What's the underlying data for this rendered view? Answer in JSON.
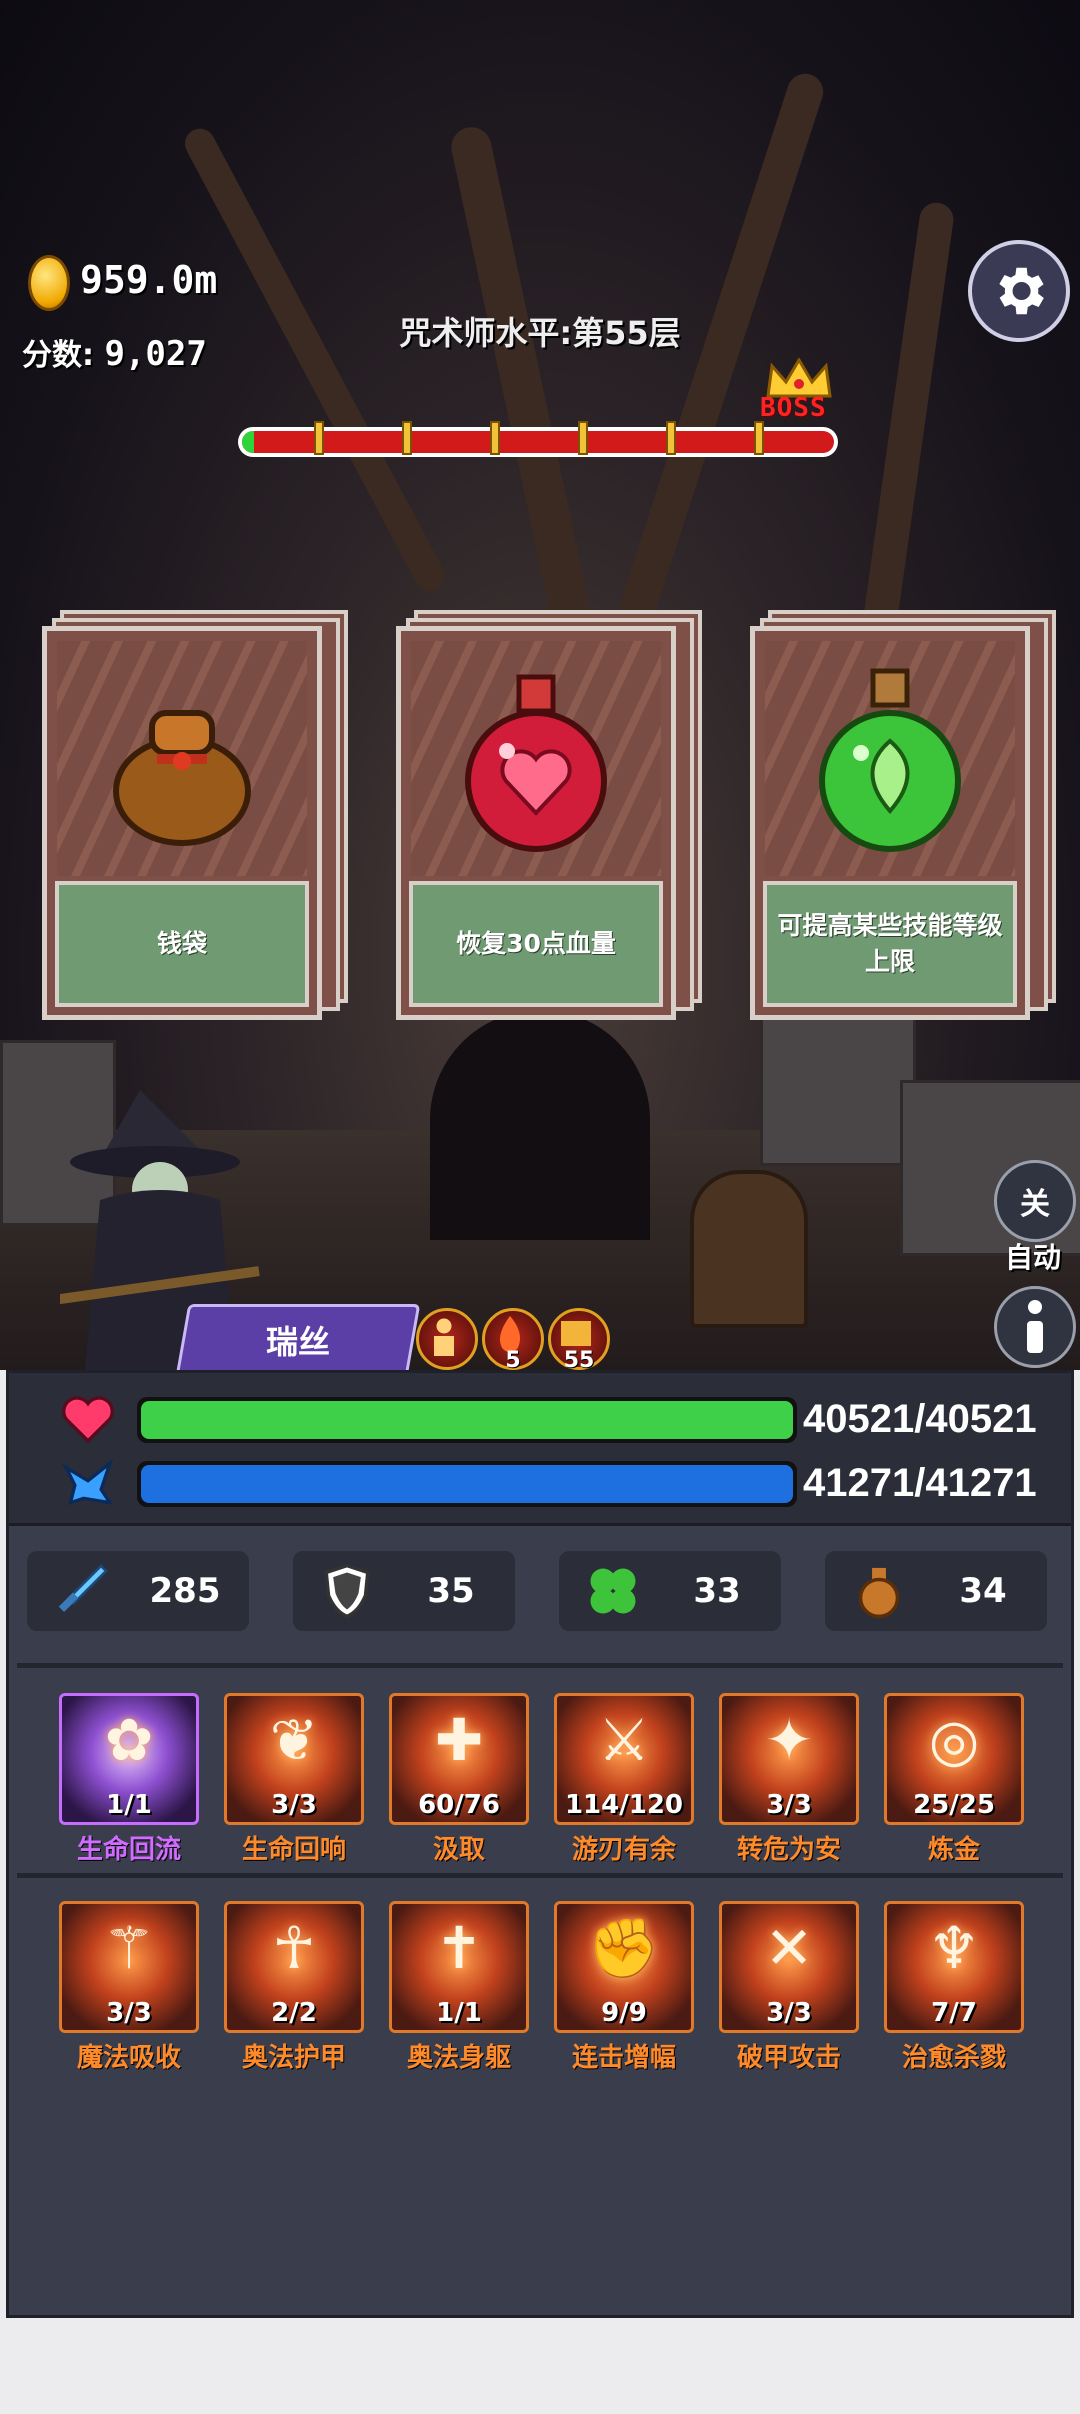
{
  "hud": {
    "gold": "959.0m",
    "score_label": "分数:",
    "score_value": "9,027",
    "level_title": "咒术师水平:第55层",
    "boss_label": "BOSS",
    "stage_progress_fraction": 0.02
  },
  "cards": [
    {
      "item": "money-bag",
      "label": "钱袋"
    },
    {
      "item": "red-heart-potion",
      "label": "恢复30点血量"
    },
    {
      "item": "green-leaf-potion",
      "label": "可提高某些技能等级上限"
    }
  ],
  "side_buttons": {
    "auto_toggle": "关",
    "auto_label": "自动",
    "info_icon": "info-icon"
  },
  "character": {
    "name": "瑞丝",
    "buffs": [
      {
        "icon": "figure-buff-icon",
        "count": ""
      },
      {
        "icon": "flame-buff-icon",
        "count": "5"
      },
      {
        "icon": "shield-buff-icon",
        "count": "55"
      }
    ]
  },
  "vitals": {
    "hp": "40521/40521",
    "hp_fraction": 1.0,
    "mp": "41271/41271",
    "mp_fraction": 1.0,
    "hp_color": "#3fd04a",
    "mp_color": "#1e6fe0"
  },
  "stats": [
    {
      "icon": "sword-icon",
      "value": "285"
    },
    {
      "icon": "shield-icon",
      "value": "35"
    },
    {
      "icon": "clover-icon",
      "value": "33"
    },
    {
      "icon": "money-bag-icon",
      "value": "34"
    }
  ],
  "skills_row1": [
    {
      "name": "生命回流",
      "level": "1/1",
      "icon": "ribbon-icon",
      "color": "purple"
    },
    {
      "name": "生命回响",
      "level": "3/3",
      "icon": "muscle-icon",
      "color": "orange"
    },
    {
      "name": "汲取",
      "level": "60/76",
      "icon": "cross-shield-icon",
      "color": "orange"
    },
    {
      "name": "游刃有余",
      "level": "114/120",
      "icon": "swirl-blade-icon",
      "color": "orange"
    },
    {
      "name": "转危为安",
      "level": "3/3",
      "icon": "sparkle-heal-icon",
      "color": "orange"
    },
    {
      "name": "炼金",
      "level": "25/25",
      "icon": "target-icon",
      "color": "orange"
    }
  ],
  "skills_row2": [
    {
      "name": "魔法吸收",
      "level": "3/3",
      "icon": "winged-staff-icon",
      "color": "orange"
    },
    {
      "name": "奥法护甲",
      "level": "2/2",
      "icon": "guardian-icon",
      "color": "orange"
    },
    {
      "name": "奥法身躯",
      "level": "1/1",
      "icon": "winged-cross-icon",
      "color": "orange"
    },
    {
      "name": "连击增幅",
      "level": "9/9",
      "icon": "combo-fist-icon",
      "color": "orange"
    },
    {
      "name": "破甲攻击",
      "level": "3/3",
      "icon": "crossed-arrows-icon",
      "color": "orange"
    },
    {
      "name": "治愈杀戮",
      "level": "7/7",
      "icon": "healing-figure-icon",
      "color": "orange"
    }
  ]
}
